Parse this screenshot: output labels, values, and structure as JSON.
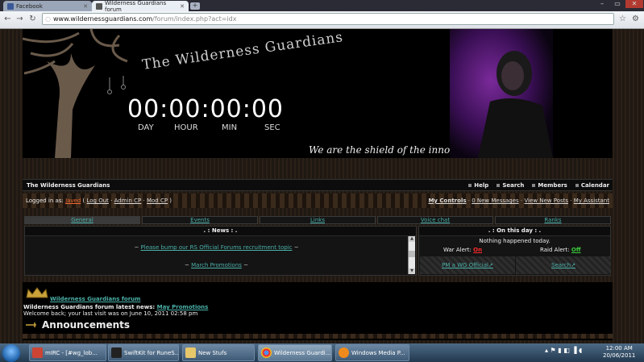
{
  "browser": {
    "tabs": [
      {
        "label": "Facebook",
        "active": false,
        "icon": "facebook-icon"
      },
      {
        "label": "Wilderness Guardians forum",
        "active": true,
        "icon": "wg-icon"
      }
    ],
    "url_host": "www.wildernessguardians.com",
    "url_path": "/forum/index.php?act=idx"
  },
  "header": {
    "site_title": "The Wilderness Guardians",
    "countdown": "00:00:00:00",
    "countdown_labels": [
      "DAY",
      "HOUR",
      "MIN",
      "SEC"
    ],
    "tagline": "We are the shield of the innocent"
  },
  "forum_bar": {
    "name": "The Wilderness Guardians",
    "links": [
      "Help",
      "Search",
      "Members",
      "Calendar"
    ]
  },
  "user_bar": {
    "logged_prefix": "Logged in as: ",
    "username": "Javed",
    "log_out": "Log Out",
    "admin_cp": "Admin CP",
    "mod_cp": "Mod CP",
    "my_controls": "My Controls",
    "new_messages": "0 New Messages",
    "view_new_posts": "View New Posts",
    "my_assistant": "My Assistant"
  },
  "tabs": [
    "General",
    "Events",
    "Links",
    "Voice chat",
    "Ranks"
  ],
  "news": {
    "title": ". : News : .",
    "line1": "Please bump our RS Official Forums recruitment topic",
    "line2": "March Promotions"
  },
  "on_this_day": {
    "title": ". : On this day : .",
    "text": "Nothing happened today.",
    "war_label": "War Alert:",
    "war_value": "On",
    "raid_label": "Raid Alert:",
    "raid_value": "Off",
    "pm_link": "PM a WG Official",
    "search_link": "Search"
  },
  "lower": {
    "category_link": "Wilderness Guardians forum",
    "latest_prefix": "Wilderness Guardians forum latest news: ",
    "latest_link": "May Promotions",
    "welcome": "Welcome back; your last visit was on June 10, 2011 02:58 pm",
    "announcements": "Announcements"
  },
  "taskbar": {
    "items": [
      {
        "label": "mIRC - [#wg_lob...",
        "icon": "mirc-icon"
      },
      {
        "label": "SwiftKit for RuneS...",
        "icon": "swiftkit-icon"
      },
      {
        "label": "New Stufs",
        "icon": "folder-icon"
      },
      {
        "label": "Wilderness Guardi...",
        "icon": "chrome-icon"
      },
      {
        "label": "Windows Media P...",
        "icon": "media-player-icon"
      }
    ],
    "time": "12:00 AM",
    "date": "20/06/2011"
  }
}
